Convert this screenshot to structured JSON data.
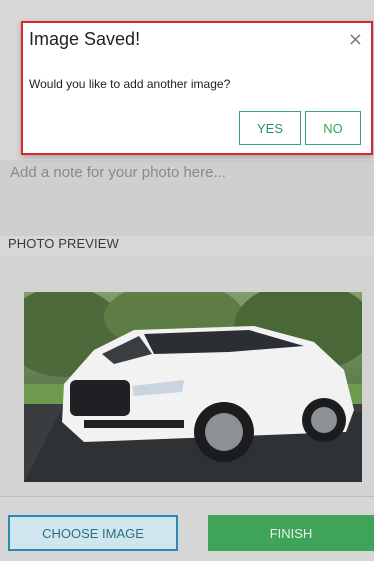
{
  "note": {
    "placeholder": "Add a note for your photo here..."
  },
  "preview": {
    "label": "PHOTO PREVIEW"
  },
  "actions": {
    "choose_label": "CHOOSE IMAGE",
    "finish_label": "FINISH"
  },
  "modal": {
    "title": "Image Saved!",
    "close_glyph": "×",
    "message": "Would you like to add another image?",
    "yes_label": "YES",
    "no_label": "NO"
  },
  "colors": {
    "modal_border": "#d9282b",
    "dialog_button_accent": "#3aa37a",
    "finish_green": "#3fa45a",
    "choose_blue": "#2b8ab0"
  }
}
